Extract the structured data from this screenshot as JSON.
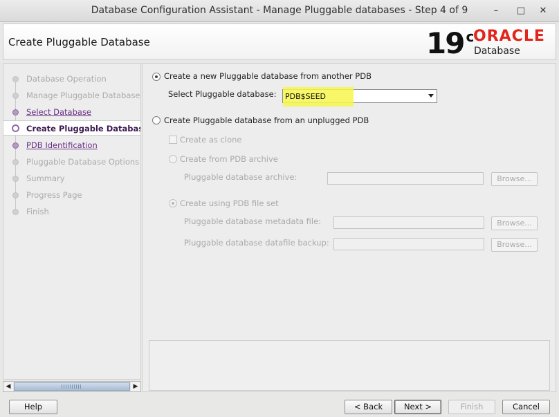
{
  "window": {
    "title": "Database Configuration Assistant - Manage Pluggable databases - Step 4 of 9",
    "minimize_icon": "minimize-icon",
    "maximize_icon": "maximize-icon",
    "close_icon": "close-icon"
  },
  "header": {
    "title": "Create Pluggable Database",
    "logo_version": "19",
    "logo_version_sup": "c",
    "logo_brand": "ORACLE",
    "logo_product": "Database"
  },
  "nav": {
    "items": [
      {
        "label": "Database Operation",
        "state": "pending"
      },
      {
        "label": "Manage Pluggable Databases",
        "state": "pending"
      },
      {
        "label": "Select Database",
        "state": "done"
      },
      {
        "label": "Create Pluggable Database",
        "state": "current"
      },
      {
        "label": "PDB Identification",
        "state": "done"
      },
      {
        "label": "Pluggable Database Options",
        "state": "pending"
      },
      {
        "label": "Summary",
        "state": "pending"
      },
      {
        "label": "Progress Page",
        "state": "pending"
      },
      {
        "label": "Finish",
        "state": "pending"
      }
    ]
  },
  "main": {
    "opt_from_pdb": "Create a new Pluggable database from another PDB",
    "select_pdb_label": "Select Pluggable database:",
    "select_pdb_value": "PDB$SEED",
    "opt_unplugged": "Create Pluggable database from an unplugged PDB",
    "create_as_clone": "Create as clone",
    "opt_pdb_archive": "Create from PDB archive",
    "archive_label": "Pluggable database archive:",
    "opt_pdb_fileset": "Create using PDB file set",
    "metadata_label": "Pluggable database metadata file:",
    "datafile_label": "Pluggable database datafile backup:",
    "browse_label": "Browse..."
  },
  "buttons": {
    "help": "Help",
    "back": "< Back",
    "next": "Next >",
    "finish": "Finish",
    "cancel": "Cancel"
  },
  "colors": {
    "highlight": "#f4f53a",
    "oracle_red": "#e2251b",
    "nav_done": "#6a2f86"
  }
}
